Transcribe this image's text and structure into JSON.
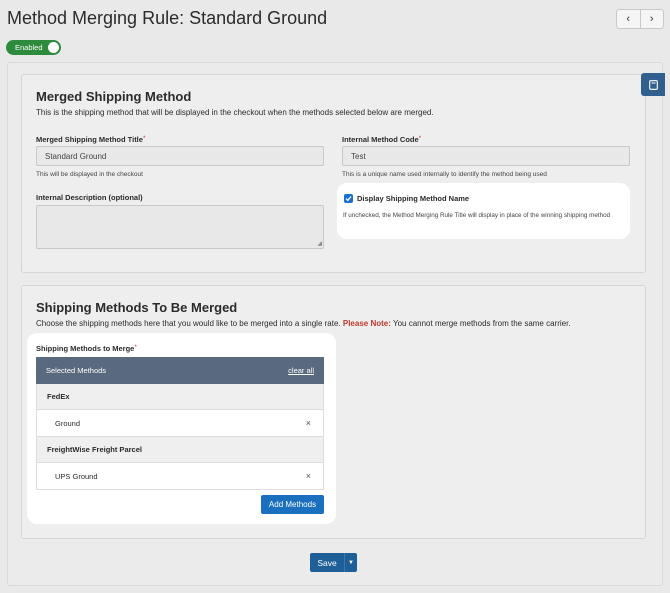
{
  "header": {
    "title": "Method Merging Rule: Standard Ground",
    "prev_icon": "chevron-left",
    "next_icon": "chevron-right",
    "prev_glyph": "‹",
    "next_glyph": "›"
  },
  "status_toggle": {
    "label": "Enabled",
    "on": true,
    "color": "#2e8b3d"
  },
  "merged_method": {
    "heading": "Merged Shipping Method",
    "description": "This is the shipping method that will be displayed in the checkout when the methods selected below are merged.",
    "title_field": {
      "label": "Merged Shipping Method Title",
      "required_mark": "*",
      "value": "Standard Ground",
      "hint": "This will be displayed in the checkout"
    },
    "code_field": {
      "label": "Internal Method Code",
      "required_mark": "*",
      "value": "Test",
      "hint": "This is a unique name used internally to identify the method being used"
    },
    "description_field": {
      "label": "Internal Description (optional)",
      "value": ""
    },
    "display_name_checkbox": {
      "label": "Display Shipping Method Name",
      "checked": true,
      "hint": "If unchecked, the Method Merging Rule Title will display in place of the winning shipping method"
    }
  },
  "methods_to_merge": {
    "heading": "Shipping Methods To Be Merged",
    "description_start": "Choose the shipping methods here that you would like to be merged into a single rate.",
    "note_label": "Please Note:",
    "note_text": "You cannot merge methods from the same carrier.",
    "field_label": "Shipping Methods to Merge",
    "required_mark": "*",
    "table": {
      "header": "Selected Methods",
      "clear_all": "clear all",
      "groups": [
        {
          "carrier": "FedEx",
          "methods": [
            "Ground"
          ]
        },
        {
          "carrier": "FreightWise Freight Parcel",
          "methods": [
            "UPS Ground"
          ]
        }
      ],
      "remove_glyph": "×"
    },
    "add_button": "Add Methods"
  },
  "footer": {
    "save_label": "Save",
    "caret_glyph": "▼"
  },
  "colors": {
    "accent": "#1a6fbf",
    "table_header": "#596a7e",
    "note": "#c0392b",
    "bookmark": "#315f8e"
  },
  "icons": {
    "bookmark": "bookmark-icon",
    "checkbox": "check-icon",
    "remove": "close-icon",
    "dropdown": "caret-down-icon"
  }
}
